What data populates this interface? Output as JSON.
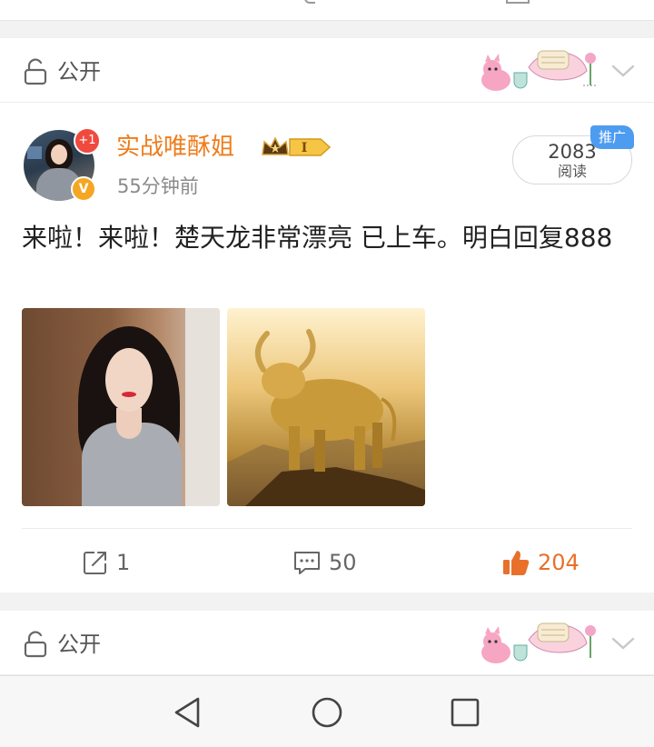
{
  "feed": {
    "top_visibility": {
      "label": "公开"
    },
    "post": {
      "author": {
        "name": "实战唯酥姐",
        "avatar_badge": "+1",
        "verified_mark": "V",
        "vip_level": "I"
      },
      "time": "55分钟前",
      "reads": {
        "count": "2083",
        "label": "阅读"
      },
      "promo_tag": "推广",
      "text": "来啦！来啦！楚天龙非常漂亮 已上车。明白回复888",
      "images": [
        "woman-portrait",
        "golden-bull"
      ],
      "actions": {
        "share_count": "1",
        "comment_count": "50",
        "like_count": "204"
      }
    },
    "bottom_visibility": {
      "label": "公开"
    }
  },
  "colors": {
    "username": "#ee7c1b",
    "like": "#e8702a",
    "promo": "#4e9cf0",
    "badge": "#f04a3e",
    "verified": "#f5a623"
  },
  "icons": [
    "unlock-icon",
    "chevron-down-icon",
    "share-icon",
    "comment-icon",
    "like-icon",
    "back-icon",
    "home-icon",
    "recents-icon"
  ]
}
